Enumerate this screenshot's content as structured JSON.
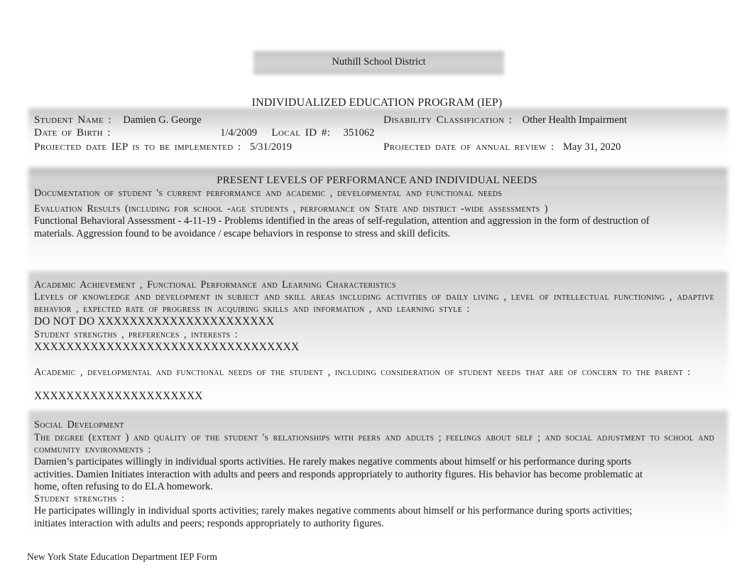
{
  "document": {
    "district_title": "Nuthill School District",
    "program_heading": "INDIVIDUALIZED EDUCATION PROGRAM (IEP)",
    "footer": "New York State Education Department IEP Form"
  },
  "student_info": {
    "student_name_label": "Student Name :",
    "student_name_value": "Damien G. George",
    "dob_label": "Date of Birth :",
    "dob_value": "1/4/2009",
    "local_id_label": "Local ID #:",
    "local_id_value": "351062",
    "projected_implementation_label": "Projected date IEP is to be implemented :",
    "projected_implementation_value": "5/31/2019",
    "disability_label": "Disability Classification :",
    "disability_value": "Other Health Impairment",
    "annual_review_label": "Projected date of annual review :",
    "annual_review_value": "May 31, 2020"
  },
  "present_levels": {
    "section_title": "PRESENT LEVELS OF PERFORMANCE AND INDIVIDUAL NEEDS",
    "documentation_label": "Documentation of student 's current performance and academic , developmental and functional needs",
    "evaluation_results_label": "Evaluation Results (including for school -age students , performance on State and district -wide assessments )",
    "evaluation_results_text": "Functional Behavioral Assessment - 4-11-19 - Problems identified in the areas of self-regulation, attention and aggression in the form of destruction of materials.    Aggression found to be avoidance / escape behaviors in response to stress and skill deficits."
  },
  "academic_achievement": {
    "heading": "Academic Achievement , Functional Performance and Learning Characteristics",
    "description": "Levels of knowledge and development in subject and skill areas including activities of daily living , level of intellectual functioning , adaptive behavior , expected rate of progress in acquiring skills and information , and learning style :",
    "description_value": "DO NOT DO XXXXXXXXXXXXXXXXXXXXXX",
    "strengths_label": "Student strengths , preferences , interests :",
    "strengths_value": "XXXXXXXXXXXXXXXXXXXXXXXXXXXXXXXXX",
    "needs_label": "Academic , developmental and functional needs of the student , including consideration of student needs that are of concern to the parent :",
    "needs_value": "XXXXXXXXXXXXXXXXXXXXX"
  },
  "social_development": {
    "heading": "Social Development",
    "description": "The degree (extent ) and quality of the student 's relationships with peers and adults ; feelings about self ; and social adjustment to school and community environments :",
    "description_value": "Damien’s participates willingly in individual sports activities. He rarely makes negative comments about himself or his performance during sports activities. Damien Initiates interaction with adults and peers and responds appropriately to authority figures. His behavior has become problematic at home, often refusing to do ELA homework.",
    "strengths_label": "Student strengths :",
    "strengths_value": "He participates willingly in individual sports activities; rarely makes negative comments about himself or his performance during sports activities; initiates interaction with adults and peers; responds appropriately to authority figures."
  }
}
